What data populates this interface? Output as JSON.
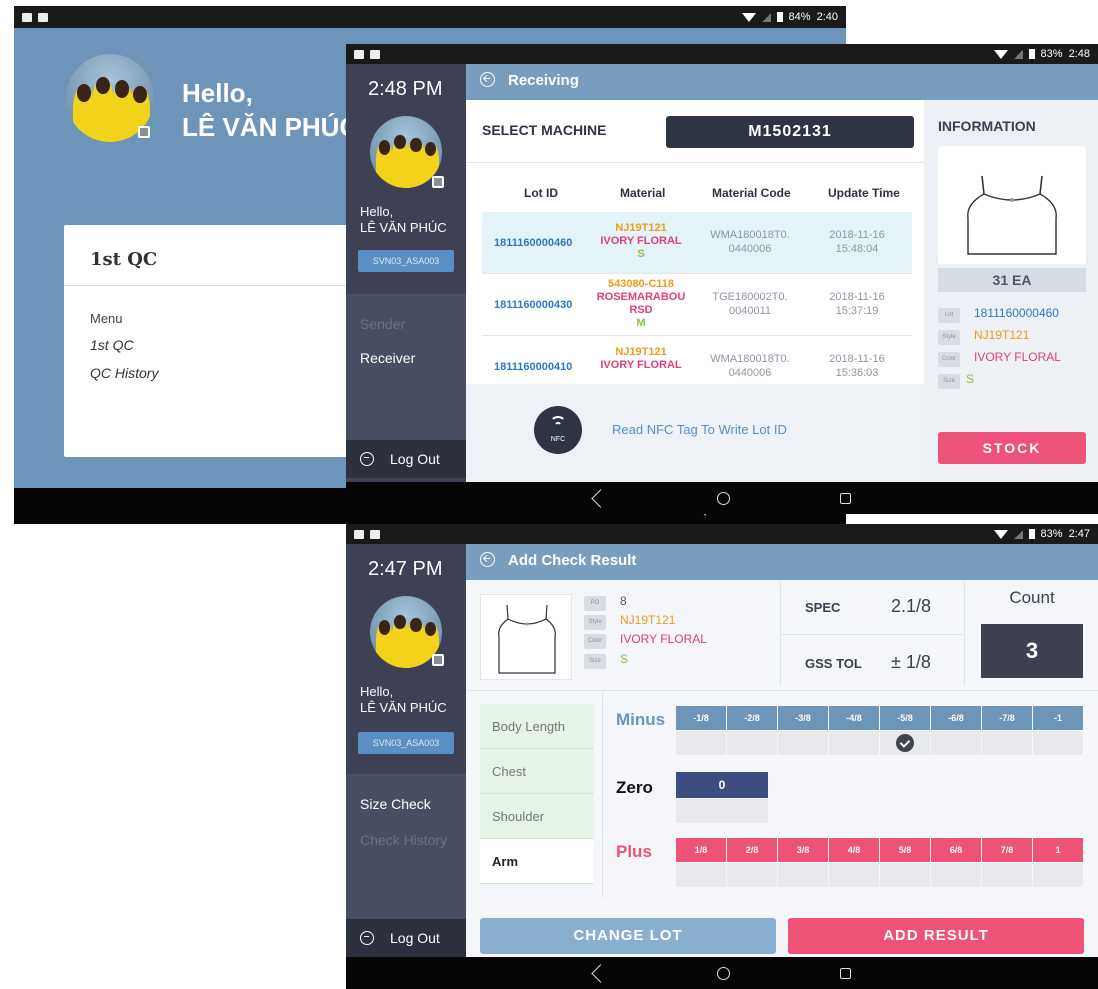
{
  "screen1": {
    "status_time": "2:40",
    "battery": "84%",
    "greeting": "Hello,",
    "user_name": "LÊ VĂN PHÚC",
    "card_title": "1st QC",
    "menu_heading": "Menu",
    "menu_items": [
      "1st QC",
      "QC History"
    ]
  },
  "screen2": {
    "status_time": "2:48",
    "battery": "83%",
    "clock": "2:48 PM",
    "greeting": "Hello,",
    "user_name": "LÊ VĂN PHÚC",
    "badge": "SVN03_ASA003",
    "menu": [
      "Sender",
      "Receiver"
    ],
    "logout": "Log Out",
    "header_title": "Receiving",
    "select_machine_label": "SELECT MACHINE",
    "machine_id": "M1502131",
    "table_headers": [
      "Lot ID",
      "Material",
      "Material Code",
      "Update Time"
    ],
    "rows": [
      {
        "lot_id": "1811160000460",
        "material_1": "NJ19T121",
        "material_2": "IVORY FLORAL",
        "material_3": "S",
        "material_4": "",
        "code_1": "WMA180018T0.",
        "code_2": "0440006",
        "date": "2018-11-16",
        "time": "15:48:04"
      },
      {
        "lot_id": "1811160000430",
        "material_1": "543080-C118",
        "material_2": "ROSEMARABOU",
        "material_3": "RSD",
        "material_4": "M",
        "code_1": "TGE180002T0.",
        "code_2": "0040011",
        "date": "2018-11-16",
        "time": "15:37:19"
      },
      {
        "lot_id": "1811160000410",
        "material_1": "NJ19T121",
        "material_2": "IVORY FLORAL",
        "material_3": "",
        "material_4": "",
        "code_1": "WMA180018T0.",
        "code_2": "0440006",
        "date": "2018-11-16",
        "time": "15:36:03"
      }
    ],
    "nfc_label": "NFC",
    "nfc_text": "Read NFC Tag To Write Lot ID",
    "info_title": "INFORMATION",
    "quantity": "31 EA",
    "info": {
      "lot_key": "Lot",
      "lot_value": "1811160000460",
      "style_key": "Style",
      "style_value": "NJ19T121",
      "color_key": "Color",
      "color_value": "IVORY FLORAL",
      "size_key": "Size",
      "size_value": "S"
    },
    "stock_button": "STOCK"
  },
  "screen3": {
    "status_time": "2:47",
    "battery": "83%",
    "clock": "2:47 PM",
    "greeting": "Hello,",
    "user_name": "LÊ VĂN PHÚC",
    "badge": "SVN03_ASA003",
    "menu": [
      "Size Check",
      "Check History"
    ],
    "logout": "Log Out",
    "header_title": "Add Check Result",
    "product": {
      "po_key": "PO",
      "po_value": "8",
      "style_key": "Style",
      "style_value": "NJ19T121",
      "color_key": "Color",
      "color_value": "IVORY FLORAL",
      "size_key": "Size",
      "size_value": "S"
    },
    "spec_label": "SPEC",
    "spec_value": "2.1/8",
    "gss_label": "GSS TOL",
    "gss_value": "± 1/8",
    "count_label": "Count",
    "count_value": "3",
    "parts": [
      "Body Length",
      "Chest",
      "Shoulder",
      "Arm"
    ],
    "minus_label": "Minus",
    "minus_cells": [
      "-1/8",
      "-2/8",
      "-3/8",
      "-4/8",
      "-5/8",
      "-6/8",
      "-7/8",
      "-1"
    ],
    "zero_label": "Zero",
    "zero_cell": "0",
    "plus_label": "Plus",
    "plus_cells": [
      "1/8",
      "2/8",
      "3/8",
      "4/8",
      "5/8",
      "6/8",
      "7/8",
      "1"
    ],
    "change_lot_button": "CHANGE LOT",
    "add_result_button": "ADD RESULT"
  },
  "colors": {
    "sidebar": "#3d4153",
    "header": "#779dbf",
    "accent_pink": "#ef5277",
    "accent_blue": "#2d78c4",
    "orange": "#f09b1a",
    "green": "#8bc34a"
  }
}
